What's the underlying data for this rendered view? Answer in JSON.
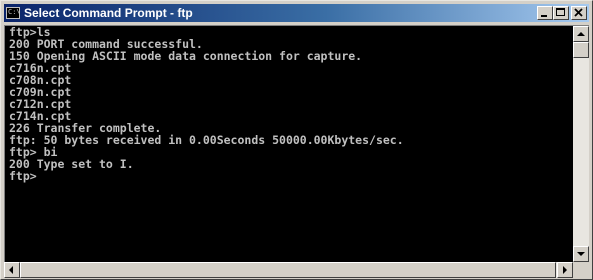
{
  "window": {
    "title": "Select Command Prompt - ftp",
    "icon_name": "command-prompt-icon",
    "title_gradient_start": "#0a246a",
    "title_gradient_end": "#a6caf0"
  },
  "titlebar_buttons": {
    "minimize": "minimize-icon",
    "maximize": "maximize-icon",
    "close": "close-icon"
  },
  "console": {
    "background": "#000000",
    "foreground": "#c0c0c0",
    "lines": [
      "ftp>ls",
      "200 PORT command successful.",
      "150 Opening ASCII mode data connection for capture.",
      "c716n.cpt",
      "c708n.cpt",
      "c709n.cpt",
      "c712n.cpt",
      "c714n.cpt",
      "226 Transfer complete.",
      "ftp: 50 bytes received in 0.00Seconds 50000.00Kbytes/sec.",
      "ftp> bi",
      "200 Type set to I.",
      "ftp>"
    ]
  },
  "scrollbars": {
    "vertical": "vertical-scrollbar",
    "horizontal": "horizontal-scrollbar"
  }
}
